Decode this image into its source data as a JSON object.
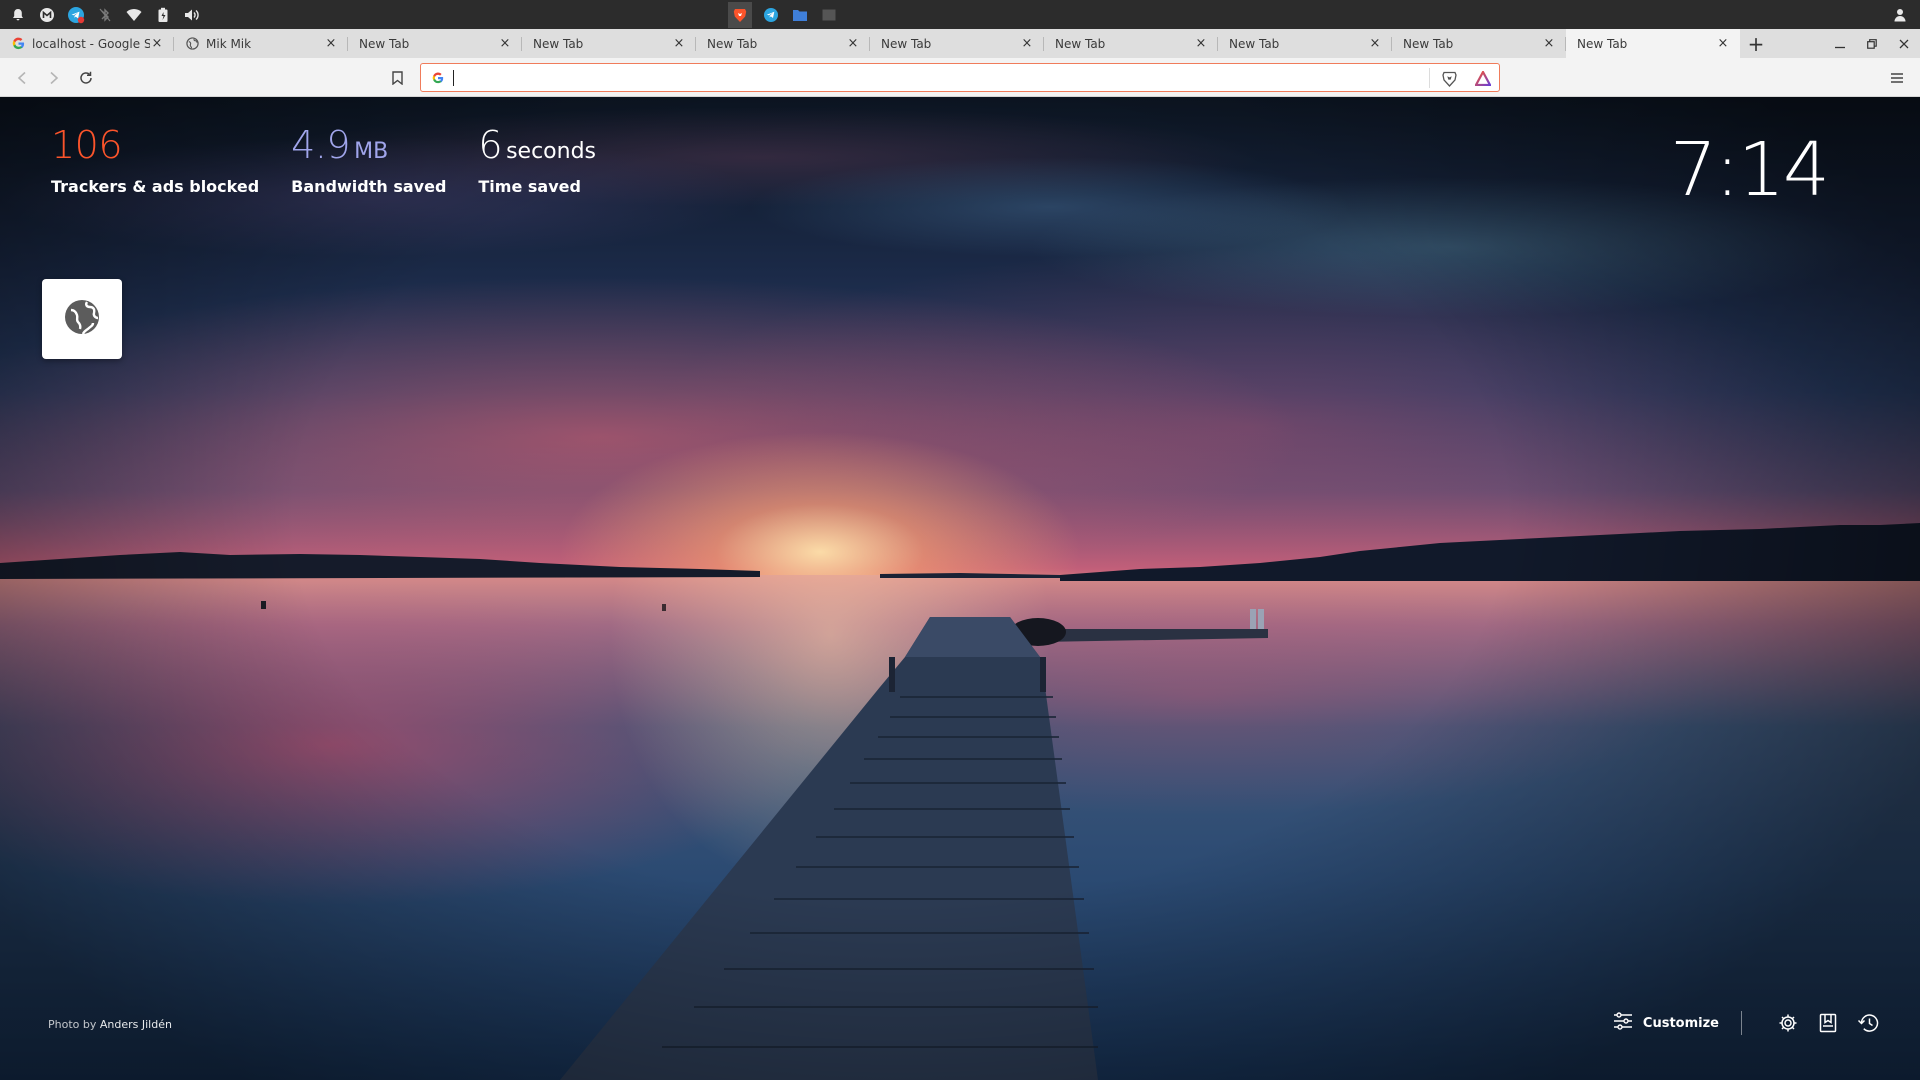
{
  "system_bar": {
    "left_icons": [
      "bell-icon",
      "mail-client-icon",
      "telegram-icon",
      "bluetooth-icon",
      "wifi-icon",
      "battery-icon",
      "volume-icon"
    ],
    "center_icons": [
      "brave-icon",
      "telegram-icon",
      "files-icon",
      "terminal-icon"
    ],
    "right_icons": [
      "user-icon"
    ]
  },
  "tabs": [
    {
      "title": "localhost - Google Se",
      "favicon": "google-icon",
      "active": false
    },
    {
      "title": "Mik Mik",
      "favicon": "globe-icon",
      "active": false
    },
    {
      "title": "New Tab",
      "favicon": "",
      "active": false
    },
    {
      "title": "New Tab",
      "favicon": "",
      "active": false
    },
    {
      "title": "New Tab",
      "favicon": "",
      "active": false
    },
    {
      "title": "New Tab",
      "favicon": "",
      "active": false
    },
    {
      "title": "New Tab",
      "favicon": "",
      "active": false
    },
    {
      "title": "New Tab",
      "favicon": "",
      "active": false
    },
    {
      "title": "New Tab",
      "favicon": "",
      "active": false
    },
    {
      "title": "New Tab",
      "favicon": "",
      "active": true
    }
  ],
  "tab_close_symbol": "×",
  "new_tab_symbol": "+",
  "omnibox": {
    "value": "",
    "placeholder": ""
  },
  "stats": {
    "trackers": {
      "value": "106",
      "unit": "",
      "label": "Trackers & ads blocked",
      "color": "#fb542b"
    },
    "bandwidth": {
      "value": "4.9",
      "unit": "MB",
      "label": "Bandwidth saved",
      "color": "#a0a5eb"
    },
    "time": {
      "value": "6",
      "unit": "seconds",
      "label": "Time saved",
      "color": "#ffffff"
    }
  },
  "clock": "7:14",
  "photo_credit": {
    "prefix": "Photo by ",
    "name": "Anders Jildén"
  },
  "bottom_controls": {
    "customize_label": "Customize"
  },
  "colors": {
    "omnibox_border": "#f07c5b",
    "brave_orange": "#fb542b"
  }
}
